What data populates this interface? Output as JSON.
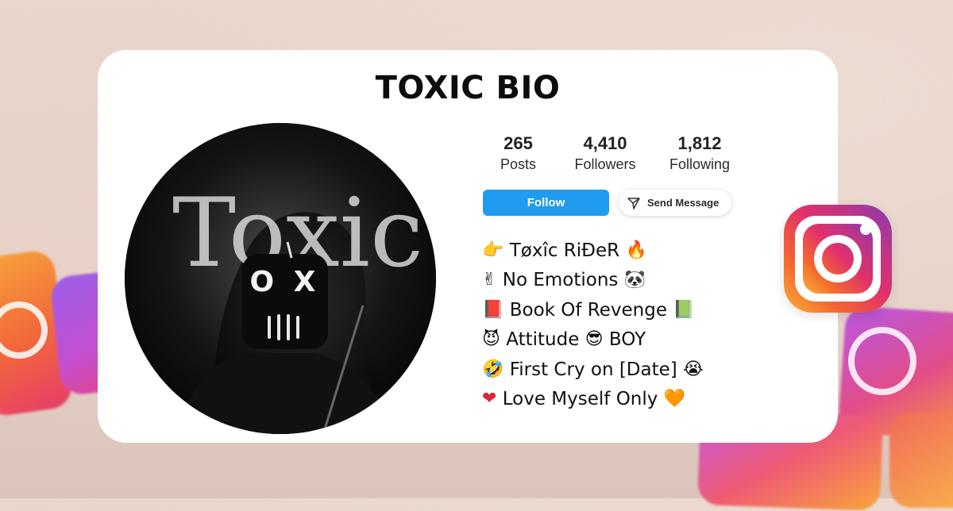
{
  "title": "TOXIC BIO",
  "profile": {
    "avatar_icon": "hooded-toxic-figure",
    "avatar_text": "Toxic",
    "mask_text": "O X"
  },
  "stats": [
    {
      "value": "265",
      "label": "Posts"
    },
    {
      "value": "4,410",
      "label": "Followers"
    },
    {
      "value": "1,812",
      "label": "Following"
    }
  ],
  "buttons": {
    "follow_label": "Follow",
    "message_label": "Send Message",
    "message_icon": "send-icon"
  },
  "bio": [
    {
      "lead": "👉",
      "text": "Tøxîc RiĐeR",
      "trail": "🔥"
    },
    {
      "lead": "✌",
      "text": "No Emotions",
      "trail": "🐼"
    },
    {
      "lead": "📕",
      "text": "Book Of Revenge",
      "trail": "📗"
    },
    {
      "lead": "😈",
      "text": "Attitude",
      "mid": "😎",
      "text2": "BOY"
    },
    {
      "lead": "🤣",
      "text": "First Cry on [Date]",
      "trail": "😭"
    },
    {
      "lead": "❤",
      "text": "Love Myself Only",
      "trail": "🧡"
    }
  ],
  "brand_icon": "instagram-logo",
  "colors": {
    "follow": "#1f9bf0",
    "title": "#0d0d0d"
  }
}
